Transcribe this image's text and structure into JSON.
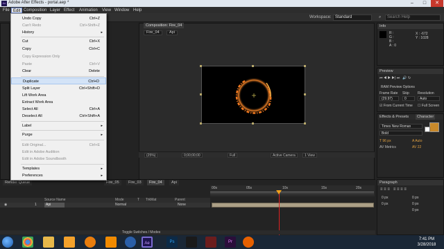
{
  "window": {
    "title": "Adobe After Effects - portal.aep *",
    "app_icon": "Ae",
    "minimize": "–",
    "maximize": "□",
    "close": "✕"
  },
  "menubar": [
    "File",
    "Edit",
    "Composition",
    "Layer",
    "Effect",
    "Animation",
    "View",
    "Window",
    "Help"
  ],
  "toolbar": {
    "workspace_label": "Workspace:",
    "workspace_value": "Standard",
    "search_placeholder": "Search Help"
  },
  "composition": {
    "tab_label": "Composition: Fire_04",
    "breadcrumbs": [
      "Fire_04",
      "Api"
    ],
    "footer": {
      "zoom": "(25%)",
      "timecode": "0;00;00;00",
      "resolution": "Full",
      "camera": "Active Camera",
      "views": "1 View"
    }
  },
  "edit_menu": {
    "items": [
      {
        "label": "Undo Copy",
        "shortcut": "Ctrl+Z",
        "disabled": false
      },
      {
        "label": "Can't Redo",
        "shortcut": "Ctrl+Shift+Z",
        "disabled": true
      },
      {
        "label": "History",
        "submenu": true
      },
      {
        "label": "Cut",
        "shortcut": "Ctrl+X"
      },
      {
        "label": "Copy",
        "shortcut": "Ctrl+C"
      },
      {
        "label": "Copy Expression Only",
        "disabled": true
      },
      {
        "label": "Paste",
        "shortcut": "Ctrl+V",
        "disabled": true
      },
      {
        "label": "Clear",
        "shortcut": "Delete"
      },
      {
        "label": "Duplicate",
        "shortcut": "Ctrl+D",
        "highlighted": true
      },
      {
        "label": "Split Layer",
        "shortcut": "Ctrl+Shift+D"
      },
      {
        "label": "Lift Work Area"
      },
      {
        "label": "Extract Work Area"
      },
      {
        "label": "Select All",
        "shortcut": "Ctrl+A"
      },
      {
        "label": "Deselect All",
        "shortcut": "Ctrl+Shift+A"
      },
      {
        "label": "Label",
        "submenu": true
      },
      {
        "label": "Purge",
        "submenu": true
      },
      {
        "label": "Edit Original...",
        "shortcut": "Ctrl+E",
        "disabled": true
      },
      {
        "label": "Edit in Adobe Audition",
        "disabled": true
      },
      {
        "label": "Edit in Adobe Soundbooth",
        "disabled": true
      },
      {
        "label": "Templates",
        "submenu": true
      },
      {
        "label": "Preferences",
        "submenu": true
      }
    ]
  },
  "info_panel": {
    "tab": "Info",
    "r": "R :",
    "g": "G :",
    "b": "B :",
    "a": "A : 0",
    "x": "X : -672",
    "y": "Y : 1028"
  },
  "preview_panel": {
    "tab": "Preview",
    "ram_preview": "RAM Preview Options",
    "frame_rate_label": "Frame Rate",
    "skip_label": "Skip",
    "resolution_label": "Resolution",
    "frame_rate_value": "(29.97)",
    "skip_value": "0",
    "resolution_value": "Auto",
    "from_current_time": "From Current Time",
    "full_screen": "Full Screen"
  },
  "character_panel": {
    "tabs": [
      "Effects & Presets",
      "Character"
    ],
    "font": "Times New Roman",
    "style": "Bold",
    "size": "96 px",
    "leading": "Auto",
    "kerning": "Metrics",
    "tracking": "22",
    "fill_color": "#c8892a"
  },
  "paragraph_panel": {
    "tab": "Paragraph",
    "values": [
      "0 px",
      "0 px",
      "0 px",
      "0 px",
      "0 px"
    ]
  },
  "timeline": {
    "tabs": [
      "Render Queue",
      "Fire_05",
      "Fire_03",
      "Fire_04",
      "Api"
    ],
    "active_tab": "Fire_04",
    "ruler": [
      "00s",
      "05s",
      "10s",
      "15s",
      "20s"
    ],
    "columns": {
      "source": "Source Name",
      "mode": "Mode",
      "t": "T",
      "trkmat": "TrkMat",
      "parent": "Parent"
    },
    "layer": {
      "index": "1",
      "name": "Api",
      "mode": "Normal",
      "parent": "None"
    },
    "toggle_label": "Toggle Switches / Modes"
  },
  "taskbar": {
    "icons": [
      "chrome-icon",
      "folder-icon",
      "media-icon",
      "blender-icon",
      "vlc-icon",
      "cinema4d-icon",
      "after-effects-icon",
      "photoshop-icon",
      "media-encoder-icon",
      "premiere-icon",
      "other-icon",
      "firefox-icon"
    ],
    "ae_label": "Ae",
    "ps_label": "Ps",
    "pr_label": "Pr",
    "time": "7:41 PM",
    "date": "3/28/2018"
  },
  "colors": {
    "menu_highlight": "#d3e3f7",
    "fire": "#e3741c",
    "playhead": "#dd2222",
    "layer_bar": "#ab9f86"
  }
}
